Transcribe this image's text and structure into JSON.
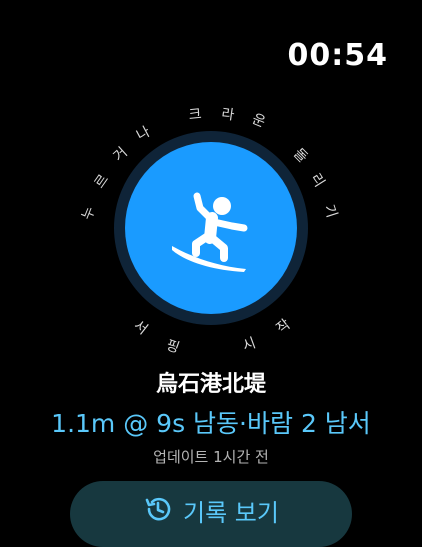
{
  "status": {
    "time": "00:54"
  },
  "crown_hint": {
    "left_chars": [
      "누",
      "르",
      "거",
      "나"
    ],
    "top_chars": [
      "크",
      "라",
      "운"
    ],
    "right_chars": [
      "돌",
      "리",
      "기"
    ],
    "bottom_left_chars": [
      "서",
      "핑"
    ],
    "bottom_right_chars": [
      "시",
      "작"
    ]
  },
  "start_button": {
    "icon": "surfer-icon",
    "color": "#1a9bff"
  },
  "spot": {
    "name": "烏石港北堤",
    "conditions": "1.1m @ 9s 남동·바람 2 남서",
    "updated": "업데이트 1시간 전"
  },
  "history": {
    "label": "기록 보기",
    "icon": "history-icon"
  },
  "colors": {
    "accent": "#5ac8fa",
    "button_fill": "#1a9bff",
    "ring": "#0f2438"
  }
}
